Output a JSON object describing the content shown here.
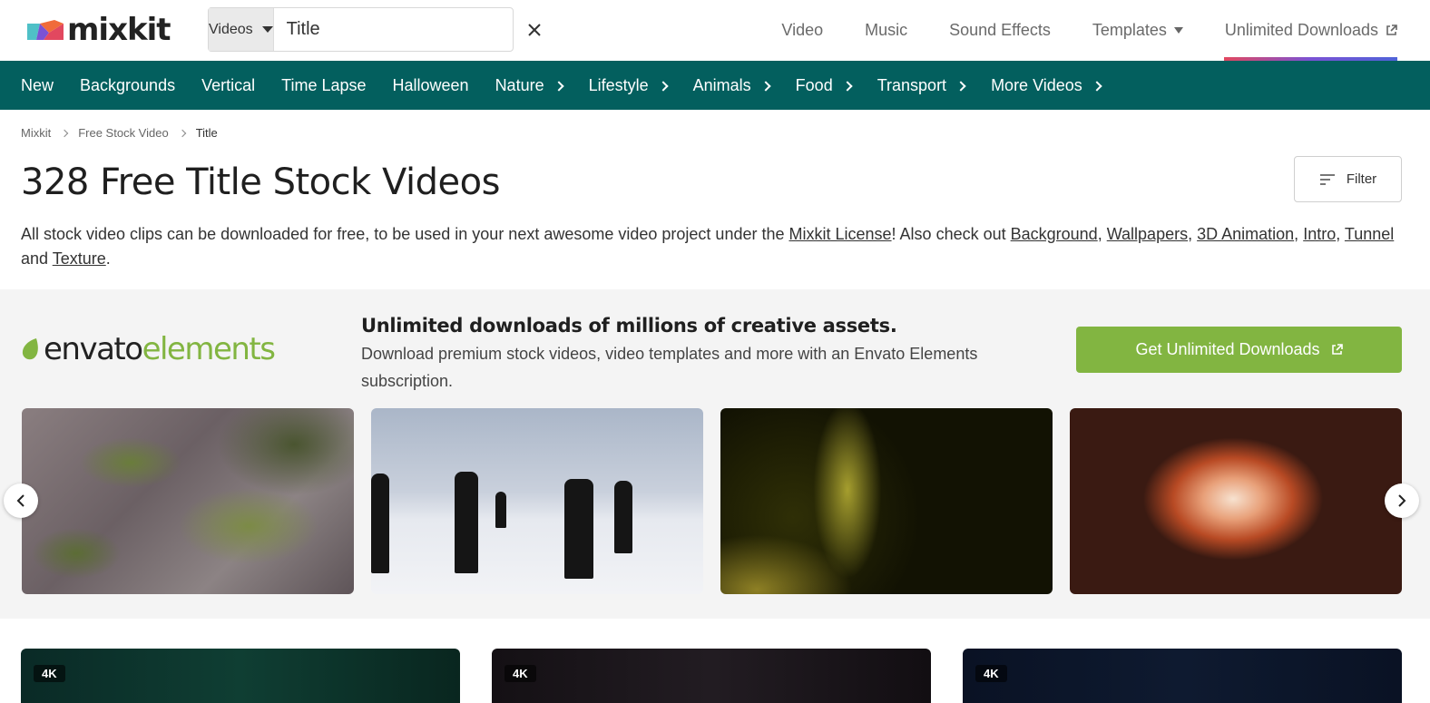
{
  "header": {
    "logo_text": "mixkit",
    "search": {
      "type_label": "Videos",
      "query": "Title"
    },
    "nav": [
      {
        "label": "Video"
      },
      {
        "label": "Music"
      },
      {
        "label": "Sound Effects"
      },
      {
        "label": "Templates"
      },
      {
        "label": "Unlimited Downloads"
      }
    ]
  },
  "categories": [
    {
      "label": "New",
      "has_chevron": false
    },
    {
      "label": "Backgrounds",
      "has_chevron": false
    },
    {
      "label": "Vertical",
      "has_chevron": false
    },
    {
      "label": "Time Lapse",
      "has_chevron": false
    },
    {
      "label": "Halloween",
      "has_chevron": false
    },
    {
      "label": "Nature",
      "has_chevron": true
    },
    {
      "label": "Lifestyle",
      "has_chevron": true
    },
    {
      "label": "Animals",
      "has_chevron": true
    },
    {
      "label": "Food",
      "has_chevron": true
    },
    {
      "label": "Transport",
      "has_chevron": true
    },
    {
      "label": "More Videos",
      "has_chevron": true
    }
  ],
  "breadcrumb": [
    "Mixkit",
    "Free Stock Video",
    "Title"
  ],
  "page": {
    "title": "328 Free Title Stock Videos",
    "filter_label": "Filter",
    "description": {
      "prefix": "All stock video clips can be downloaded for free, to be used in your next awesome video project under the ",
      "license_link": "Mixkit License",
      "middle": "! Also check out ",
      "links": [
        "Background",
        "Wallpapers",
        "3D Animation",
        "Intro",
        "Tunnel",
        "Texture"
      ],
      "and_word": " and ",
      "suffix": "."
    }
  },
  "promo": {
    "logo_word1": "envato",
    "logo_word2": "elements",
    "headline": "Unlimited downloads of millions of creative assets.",
    "subtext": "Download premium stock videos, video templates and more with an Envato Elements subscription.",
    "cta_label": "Get Unlimited Downloads",
    "accent_color": "#82b541"
  },
  "results": {
    "badges": [
      "4K",
      "4K",
      "4K"
    ]
  },
  "colors": {
    "category_bar": "#035f5e",
    "envato_green": "#82b541"
  }
}
